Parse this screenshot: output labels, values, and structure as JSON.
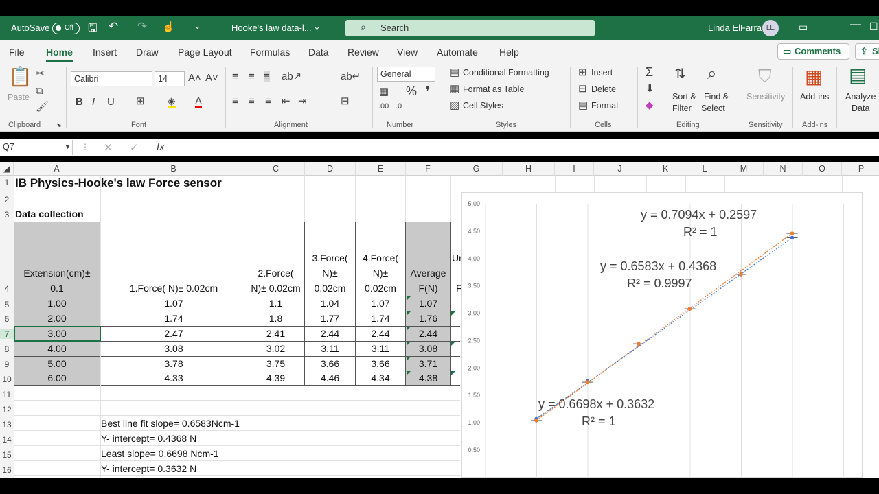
{
  "titlebar": {
    "autosave": "AutoSave",
    "autosave_state": "Off",
    "filename": "Hooke's law data-l...",
    "search": "Search",
    "user": "Linda ElFarra",
    "initials": "LE"
  },
  "tabs": [
    "File",
    "Home",
    "Insert",
    "Draw",
    "Page Layout",
    "Formulas",
    "Data",
    "Review",
    "View",
    "Automate",
    "Help"
  ],
  "comments": "Comments",
  "share": "Sh",
  "ribbon": {
    "font_name": "Calibri",
    "font_size": "14",
    "number_format": "General",
    "paste": "Paste",
    "conditional": "Conditional Formatting",
    "format_table": "Format as Table",
    "cell_styles": "Cell Styles",
    "insert": "Insert",
    "delete": "Delete",
    "format": "Format",
    "sort1": "Sort &",
    "sort2": "Filter",
    "find1": "Find &",
    "find2": "Select",
    "sensitivity": "Sensitivity",
    "addins": "Add-ins",
    "analyze1": "Analyze",
    "analyze2": "Data",
    "groups": [
      "Clipboard",
      "Font",
      "Alignment",
      "Number",
      "Styles",
      "Cells",
      "Editing",
      "Sensitivity",
      "Add-ins"
    ]
  },
  "namebox": "Q7",
  "columns": [
    "A",
    "B",
    "C",
    "D",
    "E",
    "F",
    "G",
    "H",
    "I",
    "J",
    "K",
    "L",
    "M",
    "N",
    "O",
    "P"
  ],
  "rows": [
    "1",
    "2",
    "3",
    "4",
    "5",
    "6",
    "7",
    "8",
    "9",
    "10",
    "11",
    "12",
    "13",
    "14",
    "15",
    "16"
  ],
  "sheet": {
    "title": "IB Physics-Hooke's law  Force sensor",
    "section": "Data collection",
    "headers": {
      "a1": "Extension(cm)±",
      "a2": "0.1",
      "b": "1.Force( N)± 0.02cm",
      "c1": "2.Force(",
      "c2": "N)± 0.02cm",
      "d1": "3.Force(",
      "d2": "N)±",
      "d3": "0.02cm",
      "e1": "4.Force(",
      "e2": "N)±",
      "e3": "0.02cm",
      "f1": "Average",
      "f2": "F(N)",
      "g1": "Ur",
      "g2": "F"
    },
    "data": [
      [
        "1.00",
        "1.07",
        "1.1",
        "1.04",
        "1.07",
        "1.07"
      ],
      [
        "2.00",
        "1.74",
        "1.8",
        "1.77",
        "1.74",
        "1.76"
      ],
      [
        "3.00",
        "2.47",
        "2.41",
        "2.44",
        "2.44",
        "2.44"
      ],
      [
        "4.00",
        "3.08",
        "3.02",
        "3.11",
        "3.11",
        "3.08"
      ],
      [
        "5.00",
        "3.78",
        "3.75",
        "3.66",
        "3.66",
        "3.71"
      ],
      [
        "6.00",
        "4.33",
        "4.39",
        "4.46",
        "4.34",
        "4.38"
      ]
    ],
    "notes": [
      "Best line fit slope= 0.6583Ncm-1",
      "Y- intercept= 0.4368 N",
      "Least slope= 0.6698 Ncm-1",
      "Y- intercept= 0.3632 N"
    ]
  },
  "chart_data": {
    "type": "scatter",
    "ylim": [
      0.5,
      5.0
    ],
    "yticks": [
      "5.00",
      "4.50",
      "4.00",
      "3.50",
      "3.00",
      "2.50",
      "2.00",
      "1.50",
      "1.00",
      "0.50"
    ],
    "x": [
      1,
      2,
      3,
      4,
      5,
      6
    ],
    "series": [
      {
        "values": [
          1.07,
          1.76,
          2.44,
          3.08,
          3.71,
          4.38
        ],
        "color": "#4472c4"
      },
      {
        "values": [
          1.04,
          1.74,
          2.44,
          3.08,
          3.71,
          4.46
        ],
        "color": "#ed7d31"
      }
    ],
    "annotations": [
      {
        "eq": "y = 0.7094x + 0.2597",
        "r2": "R² = 1"
      },
      {
        "eq": "y = 0.6583x + 0.4368",
        "r2": "R² = 0.9997"
      },
      {
        "eq": "y = 0.6698x + 0.3632",
        "r2": "R² = 1"
      }
    ]
  }
}
